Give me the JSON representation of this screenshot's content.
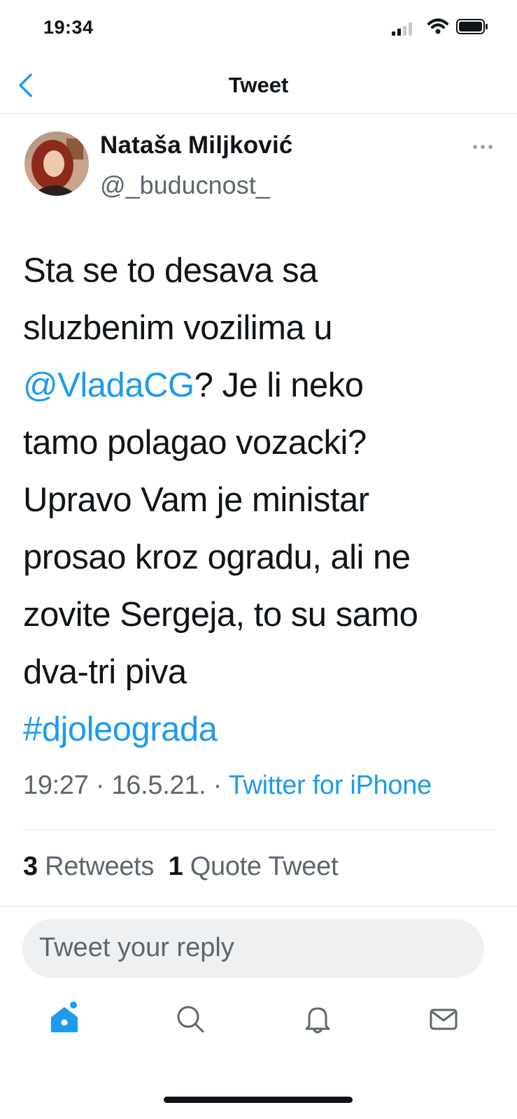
{
  "status_bar": {
    "time": "19:34"
  },
  "nav": {
    "title": "Tweet"
  },
  "author": {
    "name": "Nataša Miljković",
    "handle": "@_buducnost_"
  },
  "tweet": {
    "line1": "Sta se to desava sa",
    "line2": "sluzbenim vozilima u",
    "mention": "@VladaCG",
    "line3_rest": "? Je li neko",
    "line4": "tamo polagao vozacki?",
    "line5": "Upravo Vam je ministar",
    "line6": "prosao kroz ogradu, ali ne",
    "line7": "zovite Sergeja, to su samo",
    "line8": "dva-tri piva",
    "hashtag": "#djoleograda"
  },
  "meta": {
    "time": "19:27",
    "sep1": " · ",
    "date": "16.5.21.",
    "sep2": " · ",
    "source": "Twitter for iPhone"
  },
  "stats": {
    "retweets_count": "3",
    "retweets_label": "Retweets",
    "quotes_count": "1",
    "quotes_label": "Quote Tweet"
  },
  "reply": {
    "placeholder": "Tweet your reply"
  },
  "tabbar": {
    "icons": [
      "home-icon",
      "search-icon",
      "notifications-icon",
      "messages-icon"
    ]
  },
  "colors": {
    "accent": "#1d9bf0",
    "text": "#0f1419",
    "secondary": "#5b6670",
    "divider": "#e1e4e7",
    "input_bg": "#eef0f2"
  }
}
